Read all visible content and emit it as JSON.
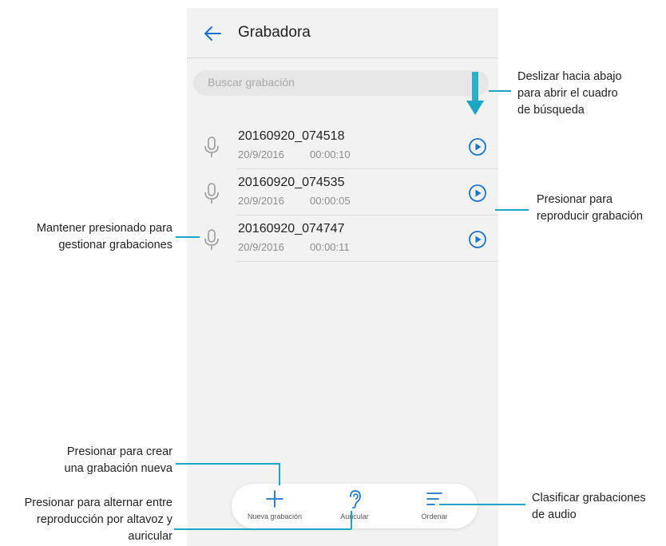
{
  "app": {
    "title": "Grabadora"
  },
  "search": {
    "placeholder": "Buscar grabación"
  },
  "recordings": [
    {
      "name": "20160920_074518",
      "date": "20/9/2016",
      "duration": "00:00:10"
    },
    {
      "name": "20160920_074535",
      "date": "20/9/2016",
      "duration": "00:00:05"
    },
    {
      "name": "20160920_074747",
      "date": "20/9/2016",
      "duration": "00:00:11"
    }
  ],
  "bottom_bar": {
    "new_label": "Nueva grabación",
    "earpiece_label": "Auricular",
    "sort_label": "Ordenar"
  },
  "annotations": {
    "swipe": [
      "Deslizar hacia abajo",
      "para abrir el cuadro",
      "de búsqueda"
    ],
    "play": [
      "Presionar para",
      "reproducir grabación"
    ],
    "hold": [
      "Mantener presionado para",
      "gestionar grabaciones"
    ],
    "create": [
      "Presionar para crear",
      "una grabación nueva"
    ],
    "toggle": [
      "Presionar para alternar entre",
      "reproducción por altavoz y",
      "auricular"
    ],
    "sort": [
      "Clasificar grabaciones",
      "de audio"
    ]
  },
  "colors": {
    "accent": "#1a73c8",
    "callout": "#1aa6c4",
    "icon_gray": "#9a9a9a"
  }
}
